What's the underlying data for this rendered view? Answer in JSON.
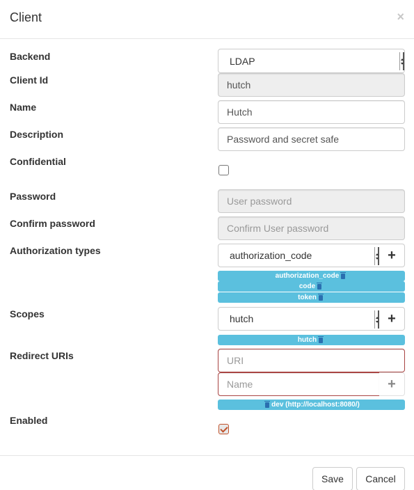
{
  "modal": {
    "title": "Client",
    "close": "×"
  },
  "form": {
    "backend": {
      "label": "Backend",
      "value": "LDAP"
    },
    "client_id": {
      "label": "Client Id",
      "value": "hutch"
    },
    "name": {
      "label": "Name",
      "value": "Hutch"
    },
    "description": {
      "label": "Description",
      "value": "Password and secret safe"
    },
    "confidential": {
      "label": "Confidential",
      "checked": false
    },
    "password": {
      "label": "Password",
      "placeholder": "User password"
    },
    "confirm_password": {
      "label": "Confirm password",
      "placeholder": "Confirm User password"
    },
    "authorization_types": {
      "label": "Authorization types",
      "selected": "authorization_code",
      "add": "+",
      "tags": [
        "authorization_code",
        "code",
        "token"
      ]
    },
    "scopes": {
      "label": "Scopes",
      "selected": "hutch",
      "add": "+",
      "tags": [
        "hutch"
      ]
    },
    "redirect_uris": {
      "label": "Redirect URIs",
      "uri_placeholder": "URI",
      "name_placeholder": "Name",
      "add": "+",
      "tags": [
        "dev (http://localhost:8080/)"
      ]
    },
    "enabled": {
      "label": "Enabled",
      "checked": true
    }
  },
  "footer": {
    "save": "Save",
    "cancel": "Cancel"
  },
  "colors": {
    "tag": "#5bc0de",
    "error_border": "#a94442",
    "checkbox_accent": "#c0522b"
  }
}
